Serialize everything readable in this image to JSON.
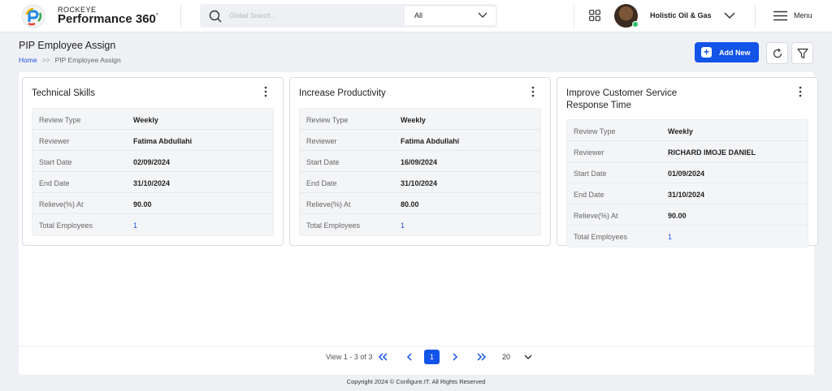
{
  "header": {
    "brand_small": "ROCKEYE",
    "brand_big": "Performance 360",
    "brand_mark": "°",
    "search": {
      "placeholder": "Global Search...",
      "scope": "All"
    },
    "company": "Holistic Oil & Gas",
    "menu_label": "Menu",
    "status_color": "#2ec26b"
  },
  "page": {
    "title": "PIP Employee Assign",
    "breadcrumb": {
      "home": "Home",
      "separator": ">>",
      "current": "PIP Employee Assign"
    },
    "add_new_label": "Add New",
    "accent": "#1253e8"
  },
  "cards": [
    {
      "title": "Technical Skills",
      "rows": [
        {
          "label": "Review Type",
          "value": "Weekly"
        },
        {
          "label": "Reviewer",
          "value": "Fatima Abdullahi"
        },
        {
          "label": "Start Date",
          "value": "02/09/2024"
        },
        {
          "label": "End Date",
          "value": "31/10/2024"
        },
        {
          "label": "Relieve(%) At",
          "value": "90.00"
        },
        {
          "label": "Total Employees",
          "value": "1"
        }
      ]
    },
    {
      "title": "Increase Productivity",
      "rows": [
        {
          "label": "Review Type",
          "value": "Weekly"
        },
        {
          "label": "Reviewer",
          "value": "Fatima Abdullahi"
        },
        {
          "label": "Start Date",
          "value": "16/09/2024"
        },
        {
          "label": "End Date",
          "value": "31/10/2024"
        },
        {
          "label": "Relieve(%) At",
          "value": "80.00"
        },
        {
          "label": "Total Employees",
          "value": "1"
        }
      ]
    },
    {
      "title": "Improve Customer Service Response Time",
      "rows": [
        {
          "label": "Review Type",
          "value": "Weekly"
        },
        {
          "label": "Reviewer",
          "value": "RICHARD IMOJE DANIEL"
        },
        {
          "label": "Start Date",
          "value": "01/09/2024"
        },
        {
          "label": "End Date",
          "value": "31/10/2024"
        },
        {
          "label": "Relieve(%) At",
          "value": "90.00"
        },
        {
          "label": "Total Employees",
          "value": "1"
        }
      ]
    }
  ],
  "pagination": {
    "info": "View 1 - 3 of 3",
    "current_page": "1",
    "page_size": "20"
  },
  "footer": {
    "copyright": "Copyright 2024 © Configure.IT. All Rights Reserved"
  }
}
